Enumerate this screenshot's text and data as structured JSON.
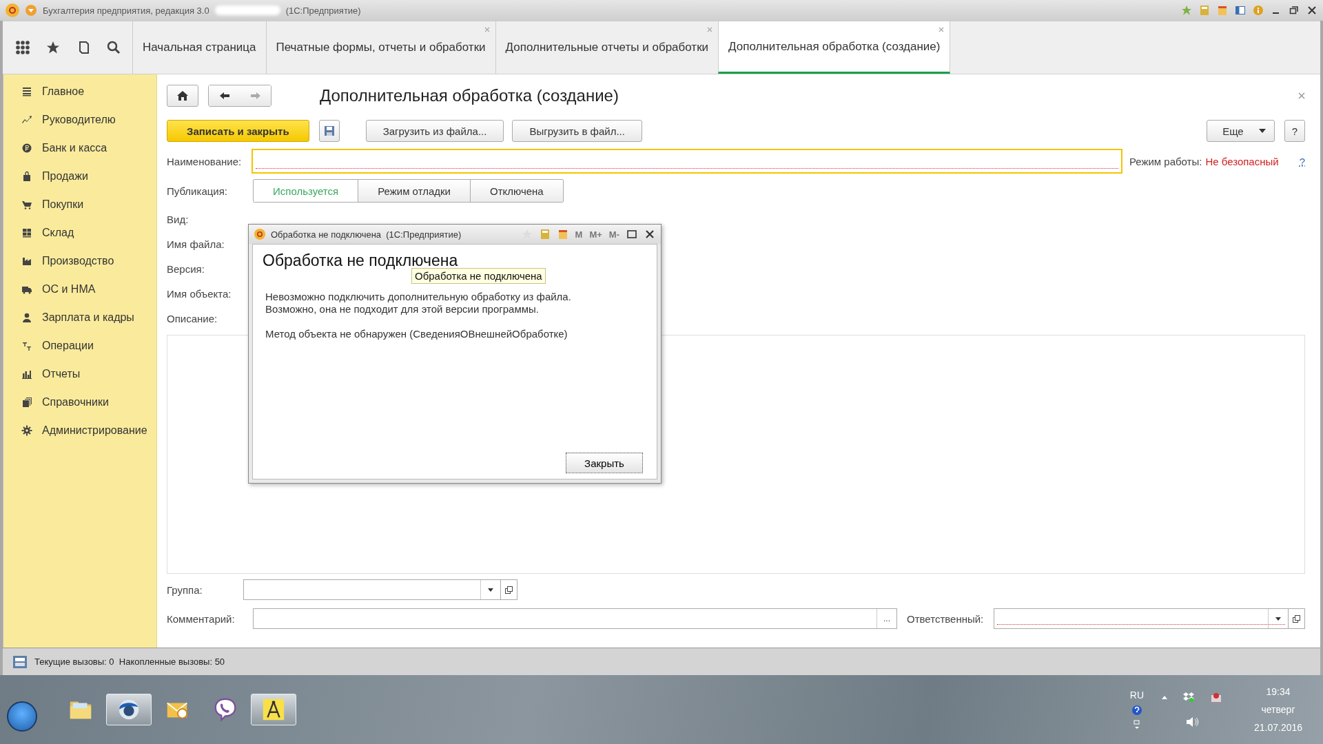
{
  "window": {
    "title": "Бухгалтерия предприятия, редакция 3.0",
    "title_suffix": "(1С:Предприятие)"
  },
  "tabs": [
    {
      "label": "Начальная страница",
      "selected": false,
      "closable": false
    },
    {
      "label": "Печатные формы, отчеты и обработки",
      "selected": false,
      "closable": true
    },
    {
      "label": "Дополнительные отчеты и обработки",
      "selected": false,
      "closable": true
    },
    {
      "label": "Дополнительная обработка (создание)",
      "selected": true,
      "closable": true
    }
  ],
  "sidebar": {
    "items": [
      {
        "label": "Главное"
      },
      {
        "label": "Руководителю"
      },
      {
        "label": "Банк и касса"
      },
      {
        "label": "Продажи"
      },
      {
        "label": "Покупки"
      },
      {
        "label": "Склад"
      },
      {
        "label": "Производство"
      },
      {
        "label": "ОС и НМА"
      },
      {
        "label": "Зарплата и кадры"
      },
      {
        "label": "Операции"
      },
      {
        "label": "Отчеты"
      },
      {
        "label": "Справочники"
      },
      {
        "label": "Администрирование"
      }
    ]
  },
  "form": {
    "title": "Дополнительная обработка (создание)",
    "buttons": [
      {
        "label": "Записать и закрыть",
        "kind": "primary"
      },
      {
        "label": "Загрузить из файла...",
        "kind": "normal"
      },
      {
        "label": "Выгрузить в файл...",
        "kind": "normal"
      }
    ],
    "more_button": "Еще",
    "help_button": "?",
    "name_field": {
      "label": "Наименование:",
      "focused": true,
      "required": true
    },
    "mode_label": "Режим работы:",
    "mode_value": "Не безопасный",
    "mode_help": "?",
    "publication": {
      "label": "Публикация:",
      "options": [
        {
          "label": "Используется",
          "selected": true
        },
        {
          "label": "Режим отладки",
          "selected": false
        },
        {
          "label": "Отключена",
          "selected": false
        }
      ]
    },
    "info_labels": [
      "Вид:",
      "Имя файла:",
      "Версия:",
      "Имя объекта:"
    ],
    "description_label": "Описание:",
    "group_field": {
      "label": "Группа:"
    },
    "comment_field": {
      "label": "Комментарий:",
      "button": "..."
    },
    "responsible_field": {
      "label": "Ответственный:",
      "required": true
    }
  },
  "dialog": {
    "title": "Обработка не подключена  (1С:Предприятие)",
    "heading": "Обработка не подключена",
    "tooltip": "Обработка не подключена",
    "message": [
      "Невозможно подключить дополнительную обработку из файла.",
      "Возможно, она не подходит для этой версии программы."
    ],
    "detail": "Метод объекта не обнаружен (СведенияОВнешнейОбработке)",
    "close_button": "Закрыть",
    "memory_buttons": [
      "M",
      "M+",
      "M-"
    ]
  },
  "status_bar": {
    "text": "Текущие вызовы: 0  Накопленные вызовы: 50"
  },
  "taskbar": {
    "apps": [
      {
        "selected": false
      },
      {
        "selected": true
      },
      {
        "selected": false
      },
      {
        "selected": false
      },
      {
        "selected": true
      }
    ],
    "language": "RU",
    "time": "19:34",
    "day": "четверг",
    "date": "21.07.2016"
  }
}
